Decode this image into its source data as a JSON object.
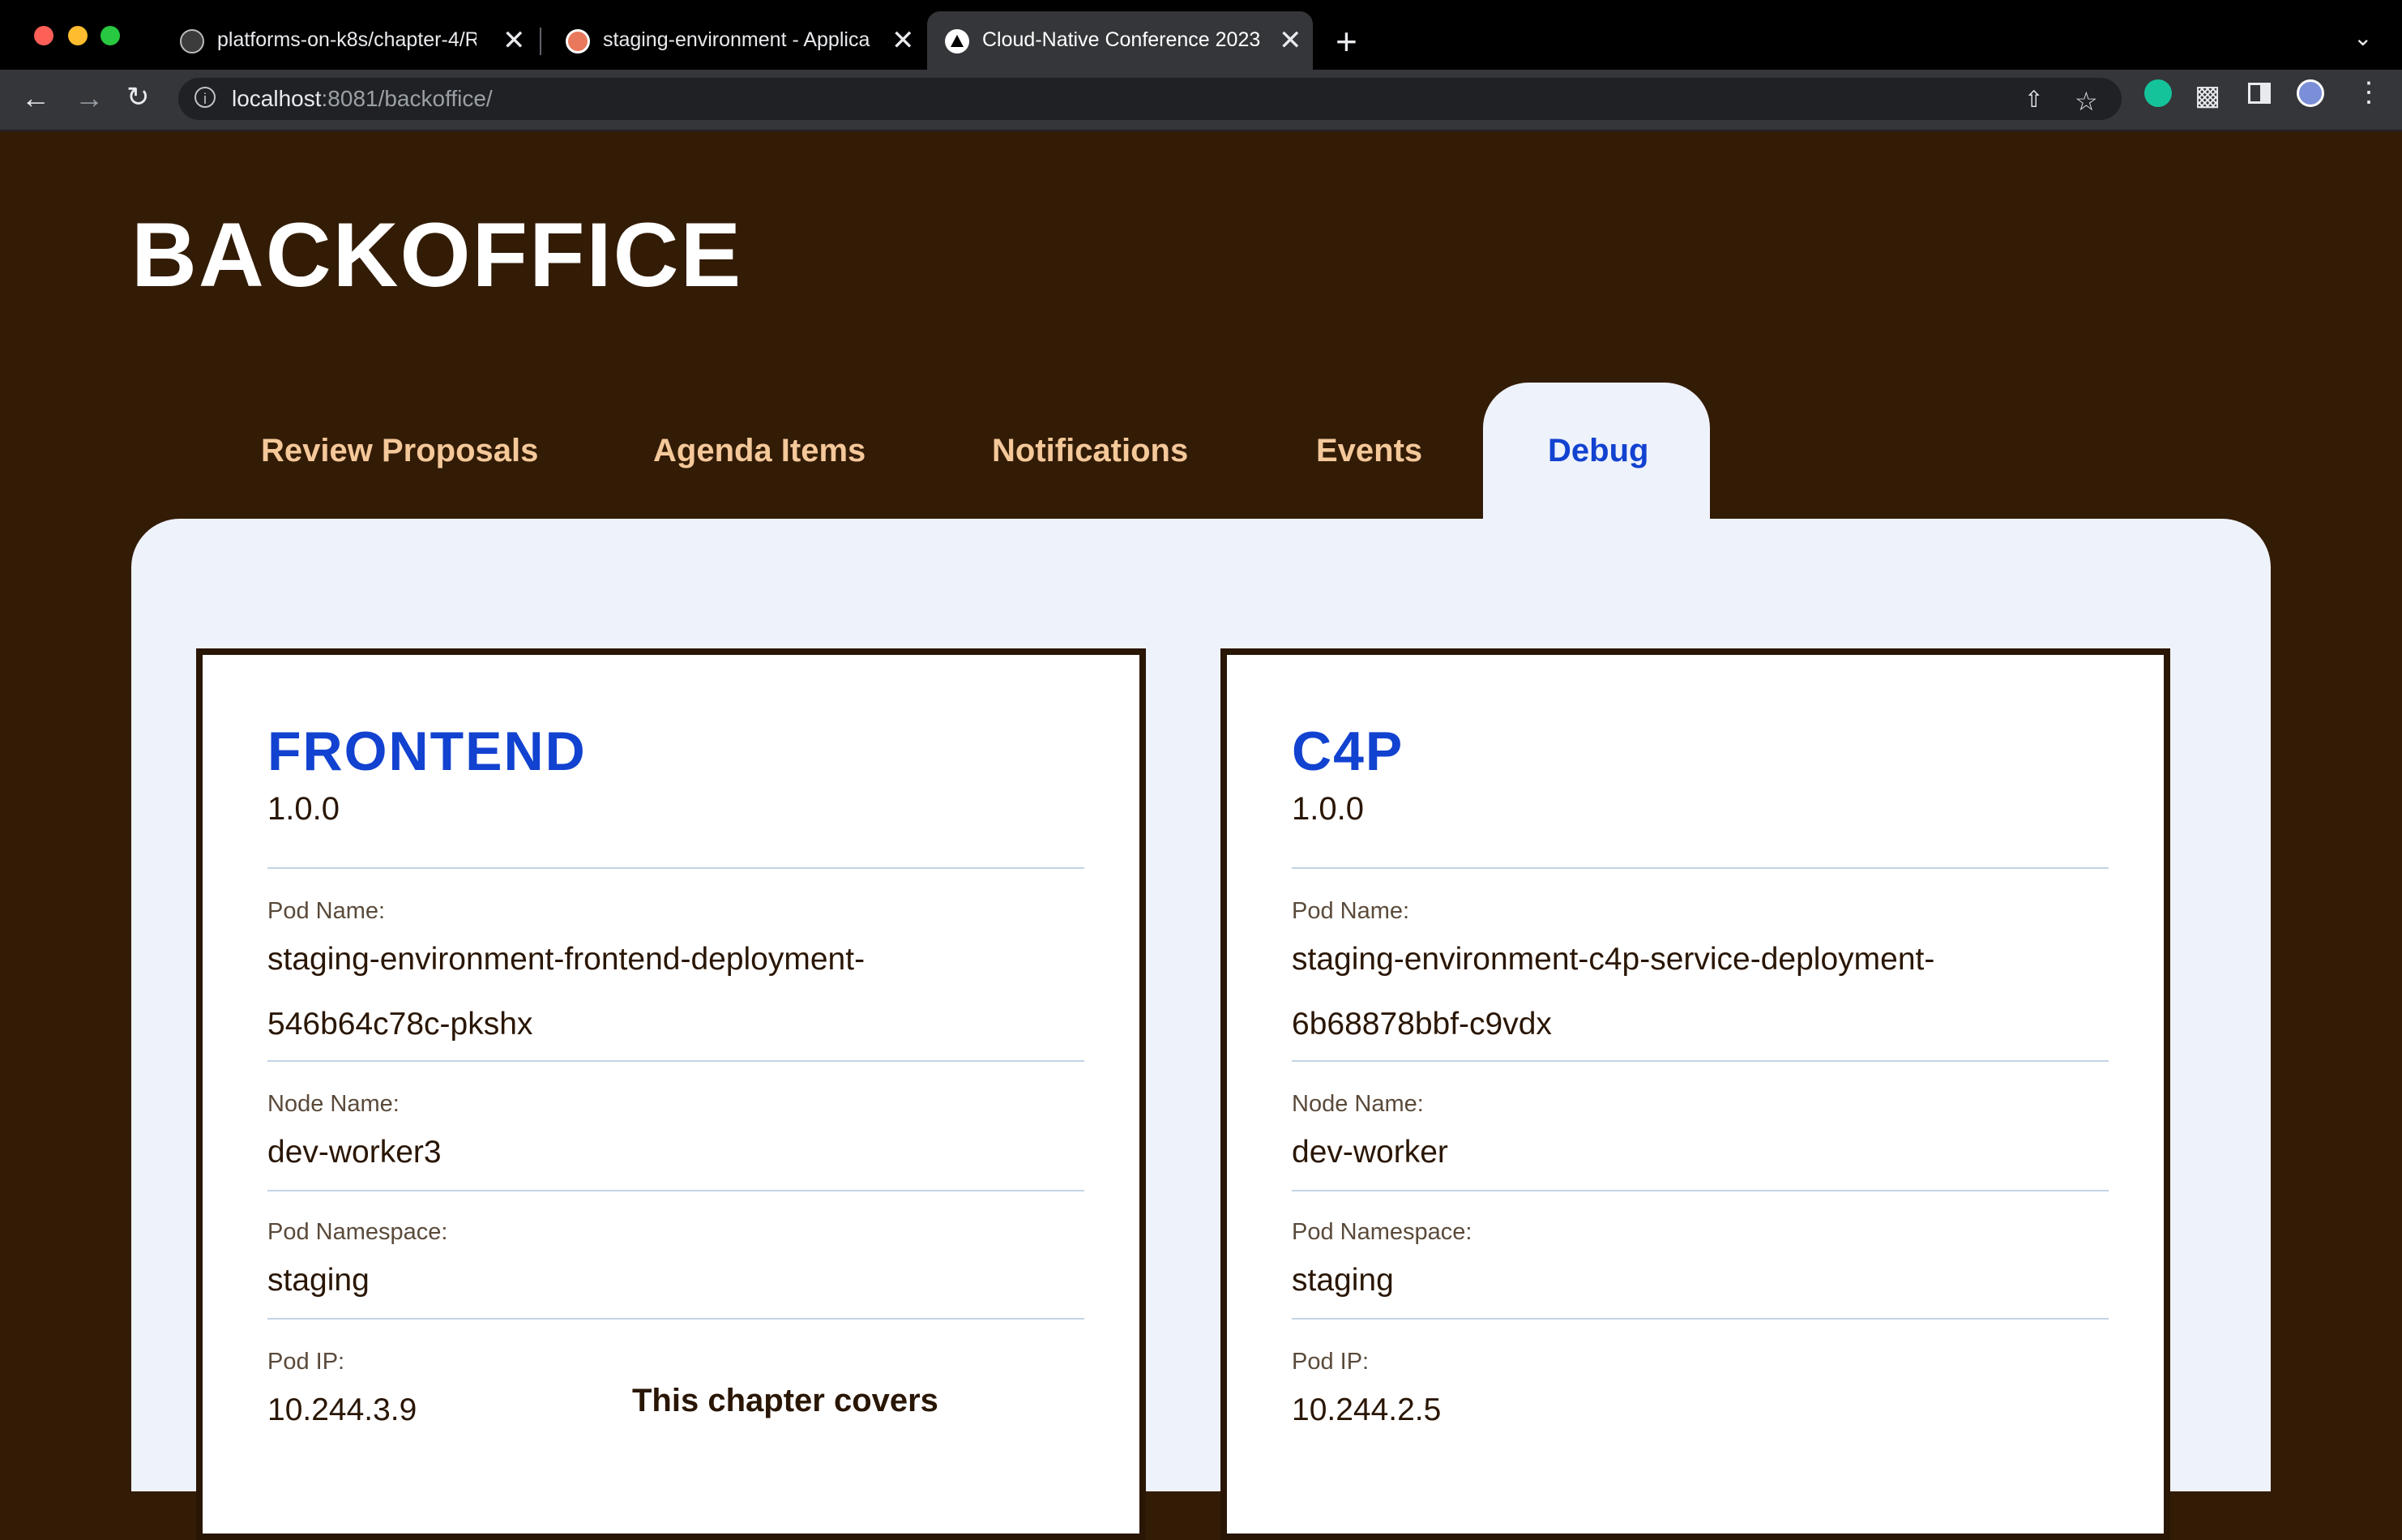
{
  "browser": {
    "tabs": [
      {
        "title": "platforms-on-k8s/chapter-4/R",
        "close": "✕"
      },
      {
        "title": "staging-environment - Applica",
        "close": "✕"
      },
      {
        "title": "Cloud-Native Conference 2023",
        "close": "✕"
      }
    ],
    "new_tab": "+",
    "url_host": "localhost",
    "url_path": ":8081/backoffice/"
  },
  "page": {
    "title": "BACKOFFICE",
    "tabs": [
      "Review Proposals",
      "Agenda Items",
      "Notifications",
      "Events",
      "Debug"
    ],
    "active_tab": "Debug"
  },
  "services": [
    {
      "name": "FRONTEND",
      "version": "1.0.0",
      "pod_name_label": "Pod Name:",
      "pod_name_line1": "staging-environment-frontend-deployment-",
      "pod_name_line2": "546b64c78c-pkshx",
      "node_name_label": "Node Name:",
      "node_name": "dev-worker3",
      "pod_namespace_label": "Pod Namespace:",
      "pod_namespace": "staging",
      "pod_ip_label": "Pod IP:",
      "pod_ip": "10.244.3.9"
    },
    {
      "name": "C4P",
      "version": "1.0.0",
      "pod_name_label": "Pod Name:",
      "pod_name_line1": "staging-environment-c4p-service-deployment-",
      "pod_name_line2": "6b68878bbf-c9vdx",
      "node_name_label": "Node Name:",
      "node_name": "dev-worker",
      "pod_namespace_label": "Pod Namespace:",
      "pod_namespace": "staging",
      "pod_ip_label": "Pod IP:",
      "pod_ip": "10.244.2.5"
    }
  ],
  "overlay_text": "This chapter covers",
  "colors": {
    "page_bg": "#331c06",
    "accent_blue": "#1242d0",
    "tab_text": "#f5c89a",
    "panel_bg": "#eef2fb"
  }
}
